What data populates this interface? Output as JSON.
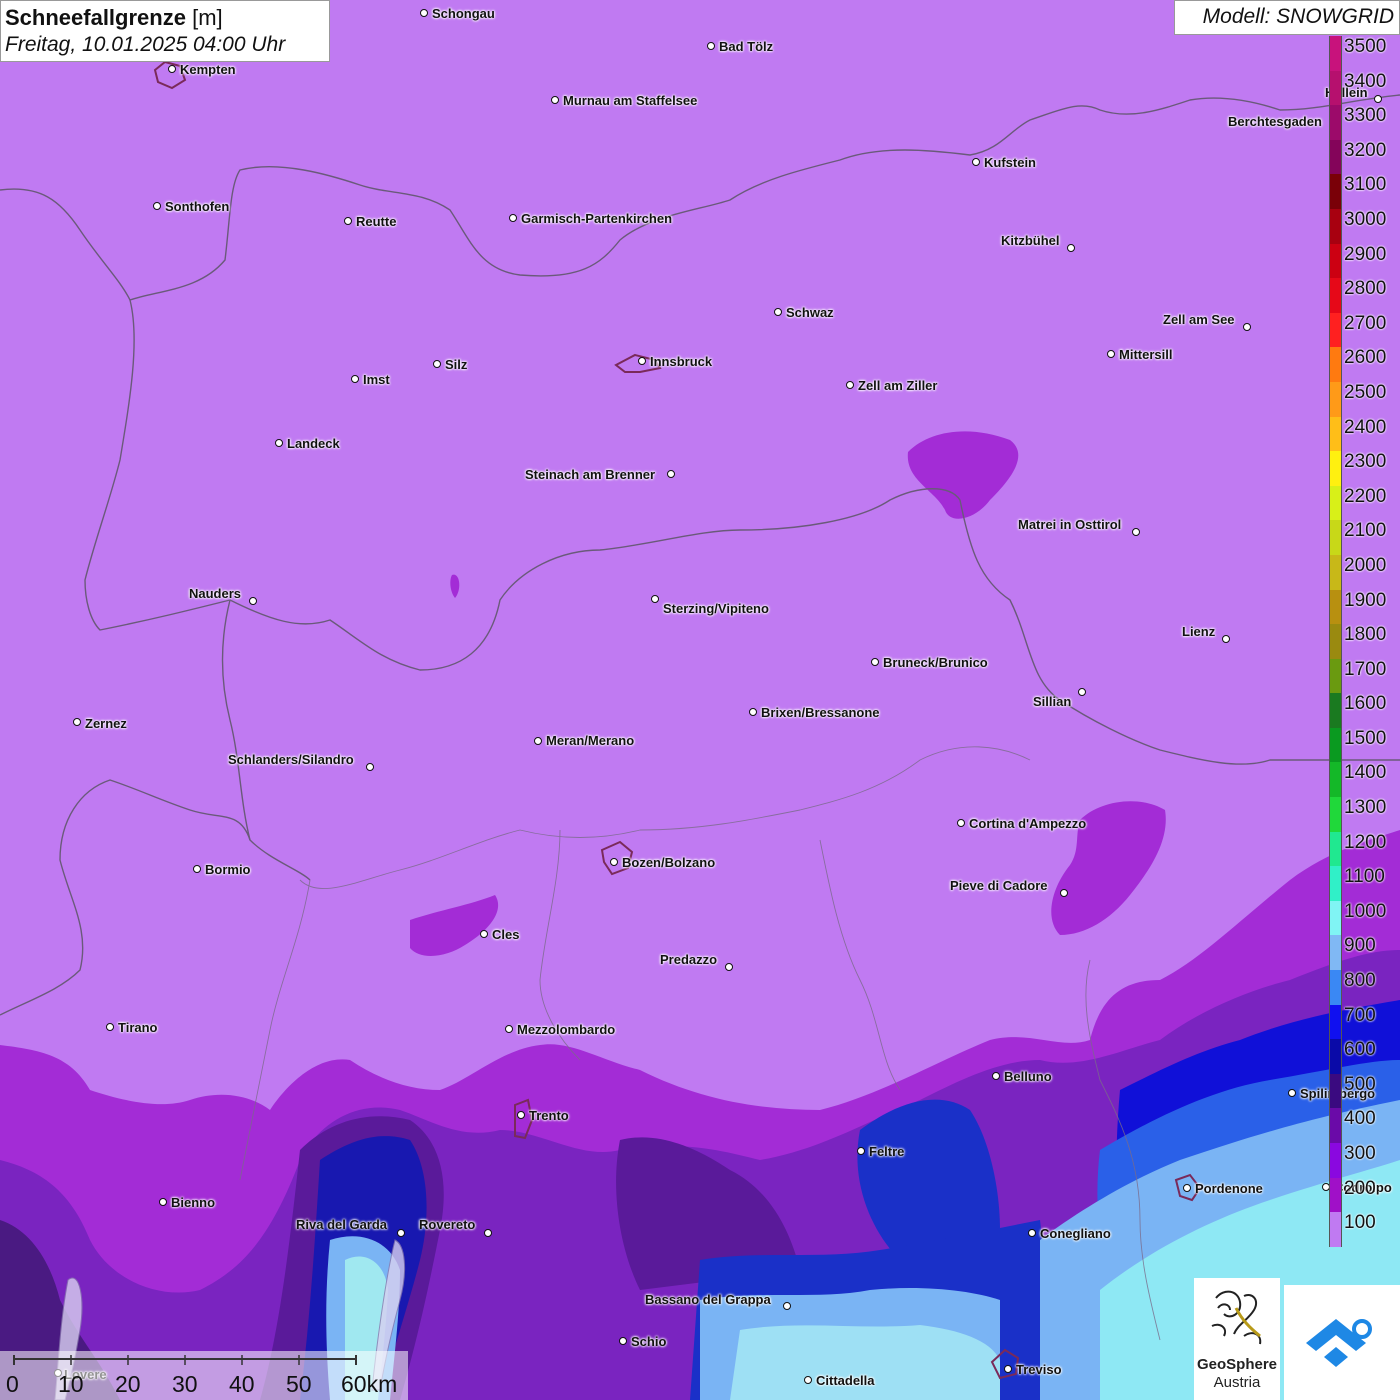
{
  "title": {
    "main": "Schneefallgrenze",
    "unit": "[m]",
    "date": "Freitag, 10.01.2025 04:00 Uhr"
  },
  "model": "Modell: SNOWGRID",
  "legend": [
    {
      "label": "3500",
      "color": "#c8127c"
    },
    {
      "label": "3400",
      "color": "#b6106e"
    },
    {
      "label": "3300",
      "color": "#9c0a6a"
    },
    {
      "label": "3200",
      "color": "#84045a"
    },
    {
      "label": "3100",
      "color": "#7a0008"
    },
    {
      "label": "3000",
      "color": "#a80010"
    },
    {
      "label": "2900",
      "color": "#cc0012"
    },
    {
      "label": "2800",
      "color": "#e60818"
    },
    {
      "label": "2700",
      "color": "#ff2020"
    },
    {
      "label": "2600",
      "color": "#ff7a10"
    },
    {
      "label": "2500",
      "color": "#ff9a18"
    },
    {
      "label": "2400",
      "color": "#ffbe18"
    },
    {
      "label": "2300",
      "color": "#fff010"
    },
    {
      "label": "2200",
      "color": "#d8f018"
    },
    {
      "label": "2100",
      "color": "#c8d818"
    },
    {
      "label": "2000",
      "color": "#c8b818"
    },
    {
      "label": "1900",
      "color": "#b89010"
    },
    {
      "label": "1800",
      "color": "#9a8a10"
    },
    {
      "label": "1700",
      "color": "#6a9a10"
    },
    {
      "label": "1600",
      "color": "#1a7a20"
    },
    {
      "label": "1500",
      "color": "#0a9a20"
    },
    {
      "label": "1400",
      "color": "#14b828"
    },
    {
      "label": "1300",
      "color": "#20d83a"
    },
    {
      "label": "1200",
      "color": "#20e890"
    },
    {
      "label": "1100",
      "color": "#30f0c8"
    },
    {
      "label": "1000",
      "color": "#80f4f4"
    },
    {
      "label": "900",
      "color": "#80b8f4"
    },
    {
      "label": "800",
      "color": "#3a88f4"
    },
    {
      "label": "700",
      "color": "#1010f0"
    },
    {
      "label": "600",
      "color": "#0a0aa8"
    },
    {
      "label": "500",
      "color": "#3a0a80"
    },
    {
      "label": "400",
      "color": "#6a0aa8"
    },
    {
      "label": "300",
      "color": "#8a08e0"
    },
    {
      "label": "200",
      "color": "#a010c8"
    },
    {
      "label": "100",
      "color": "#c07af2"
    }
  ],
  "cities": [
    "Schongau",
    "Bad Tölz",
    "Kempten",
    "Murnau am Staffelsee",
    "Berchtesgaden",
    "Kufstein",
    "Sonthofen",
    "Reutte",
    "Garmisch-Partenkirchen",
    "Kitzbühel",
    "Schwaz",
    "Zell am See",
    "Innsbruck",
    "Mittersill",
    "Imst",
    "Silz",
    "Zell am Ziller",
    "Landeck",
    "Steinach am Brenner",
    "Matrei in Osttirol",
    "Nauders",
    "Sterzing/Vipiteno",
    "Lienz",
    "Bruneck/Brunico",
    "Sillian",
    "Zernez",
    "Brixen/Bressanone",
    "Meran/Merano",
    "Schlanders/Silandro",
    "Cortina d'Ampezzo",
    "Bormio",
    "Bozen/Bolzano",
    "Pieve di Cadore",
    "Cles",
    "Predazzo",
    "Tirano",
    "Mezzolombardo",
    "Belluno",
    "Spilimbergo",
    "Trento",
    "Feltre",
    "Pordenone",
    "Bienno",
    "Riva del Garda",
    "Rovereto",
    "Conegliano",
    "Bassano del Grappa",
    "Schio",
    "Treviso",
    "Cittadella",
    "Hallein",
    "Lovere",
    "Codroipo"
  ],
  "scalebar": {
    "labels": [
      "0",
      "10",
      "20",
      "30",
      "40",
      "50",
      "60km"
    ]
  },
  "logo": {
    "name_line1": "GeoSphere",
    "name_line2": "Austria"
  }
}
